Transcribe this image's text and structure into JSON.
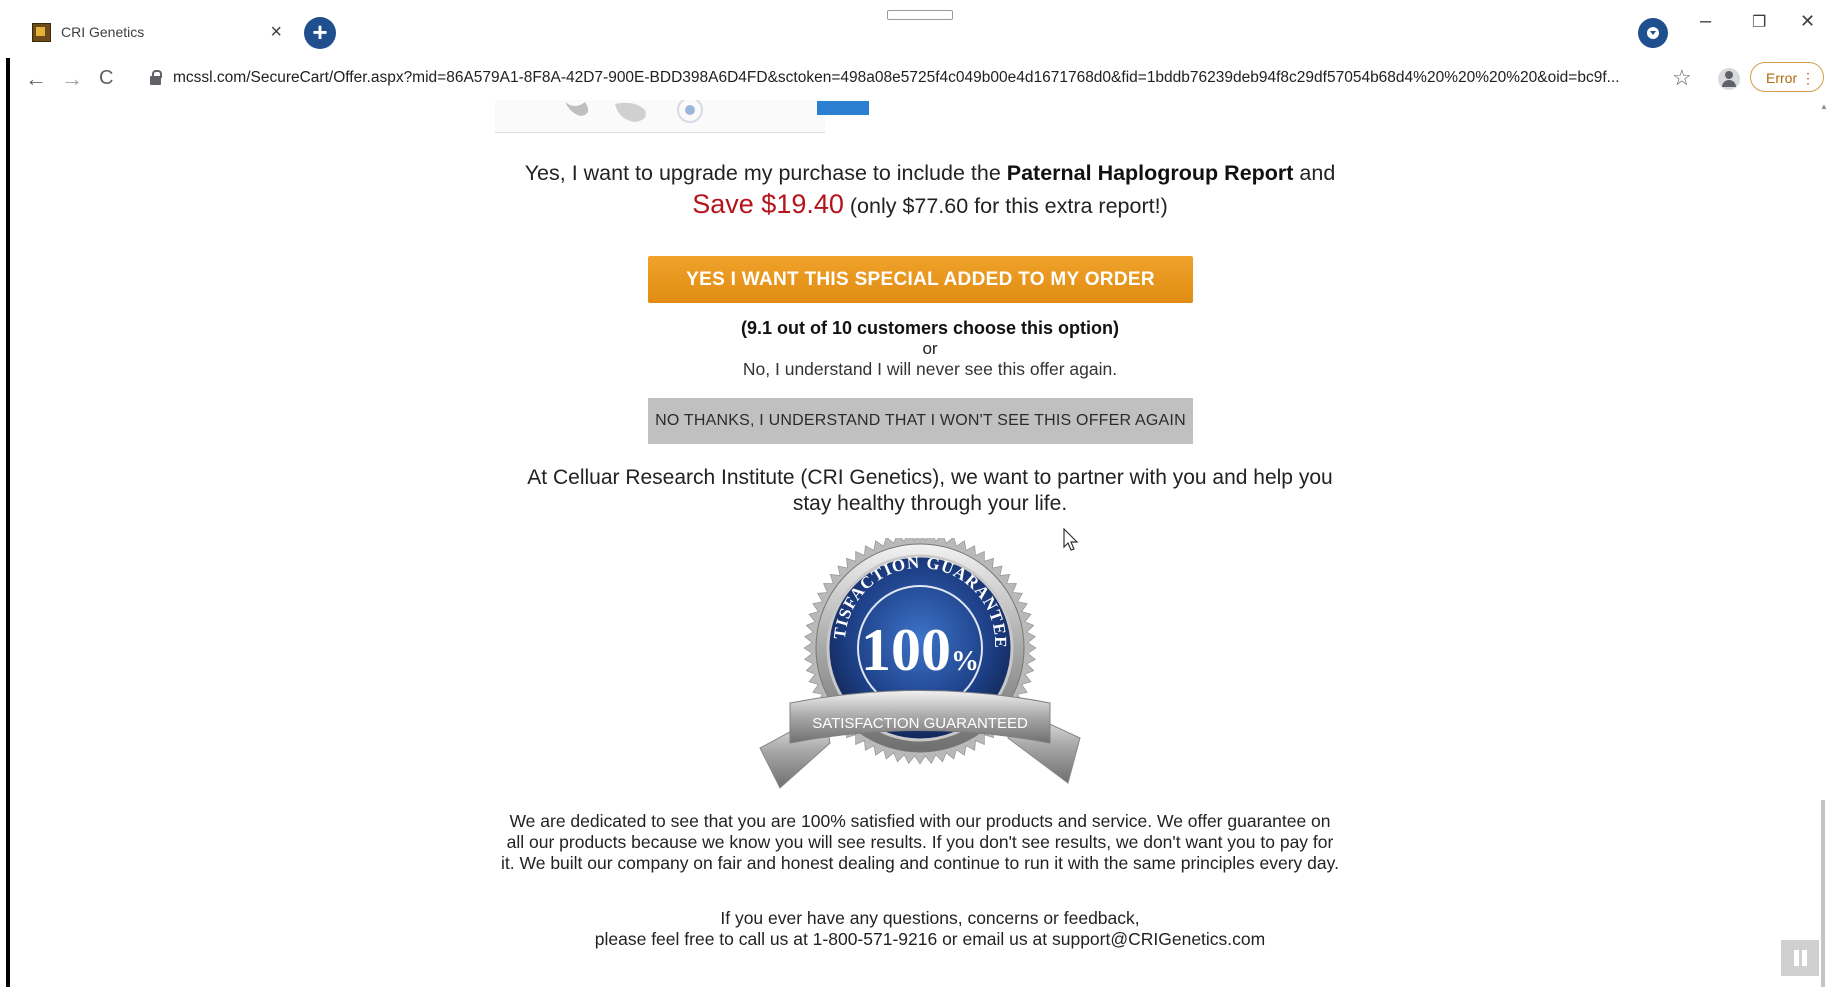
{
  "browser": {
    "tab_title": "CRI Genetics",
    "tab_close": "×",
    "new_tab": "+",
    "url": "mcssl.com/SecureCart/Offer.aspx?mid=86A579A1-8F8A-42D7-900E-BDD398A6D4FD&sctoken=498a08e5725f4c049b00e4d1671768d0&fid=1bddb76239deb94f8c29df57054b68d4%20%20%20%20&oid=bc9f...",
    "error_label": "Error",
    "menu_glyph": "⋮",
    "back": "←",
    "forward": "→",
    "reload": "C",
    "star": "☆",
    "minimize": "–",
    "restore": "❐",
    "close": "✕"
  },
  "offer": {
    "upgrade_prefix": "Yes, I want to upgrade my purchase to include the ",
    "report_name": "Paternal Haplogroup Report",
    "upgrade_suffix": " and",
    "save_text": "Save $19.40",
    "only_text": " (only $77.60 for this extra report!)",
    "yes_button": "YES I WANT THIS SPECIAL ADDED TO MY ORDER",
    "choose_text": "(9.1 out of 10 customers choose this option)",
    "or_text": "or",
    "never_text": "No, I understand I will never see this offer again.",
    "no_button": "NO THANKS, I UNDERSTAND THAT I WON'T SEE THIS OFFER AGAIN"
  },
  "partner": {
    "line1": "At Celluar Research Institute (CRI Genetics), we want to partner with you and help you",
    "line2": "stay healthy through your life."
  },
  "seal": {
    "top_text": "SATISFACTION GUARANTEED",
    "percent": "100",
    "percent_sign": "%",
    "ribbon_text": "SATISFACTION GUARANTEED"
  },
  "guarantee": {
    "line1": "We are dedicated to see that you are 100% satisfied with our products and service. We offer guarantee on",
    "line2": "all our products because we know you will see results. If you don't see results, we don't want you to pay for",
    "line3": "it. We built our company on fair and honest dealing and continue to run it with the same principles every day."
  },
  "contact": {
    "line1": "If you ever have any questions, concerns or feedback,",
    "line2": "please feel free to call us at 1-800-571-9216 or email us at support@CRIGenetics.com"
  },
  "colors": {
    "accent_orange": "#e8951c",
    "save_red": "#b5141b",
    "brand_blue": "#1f4f8f",
    "no_button_gray": "#c0c0c0"
  }
}
